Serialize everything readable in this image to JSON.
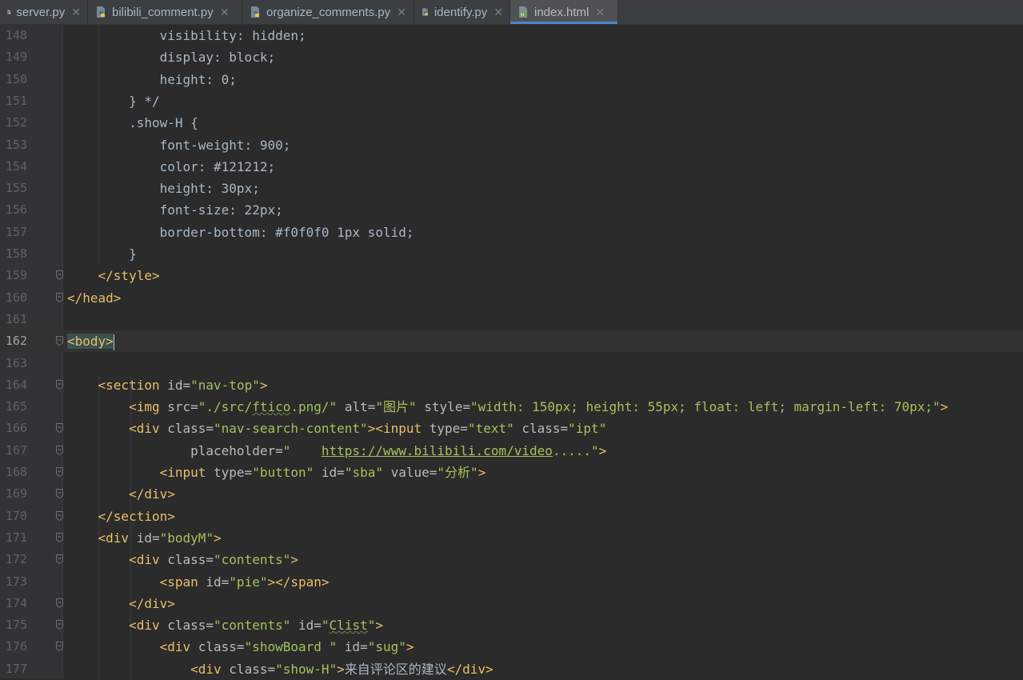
{
  "tabs": [
    {
      "label": "server.py",
      "icon": "python-file-icon",
      "active": false
    },
    {
      "label": "bilibili_comment.py",
      "icon": "python-file-icon",
      "active": false
    },
    {
      "label": "organize_comments.py",
      "icon": "python-file-icon",
      "active": false
    },
    {
      "label": "identify.py",
      "icon": "python-file-icon",
      "active": false
    },
    {
      "label": "index.html",
      "icon": "html-file-icon",
      "active": true
    }
  ],
  "colors": {
    "background": "#2b2b2b",
    "gutter": "#313335",
    "tag": "#e8bf6a",
    "string": "#a5c25c",
    "text": "#a9b7c6",
    "line_number": "#606366",
    "active_tab_underline": "#4a88c7"
  },
  "current_line": "162",
  "lines": [
    {
      "n": "148",
      "fold": false,
      "parts": [
        {
          "t": "            visibility: hidden;",
          "c": "kw"
        }
      ]
    },
    {
      "n": "149",
      "fold": false,
      "parts": [
        {
          "t": "            display: block;",
          "c": "kw"
        }
      ]
    },
    {
      "n": "150",
      "fold": false,
      "parts": [
        {
          "t": "            height: 0;",
          "c": "kw"
        }
      ]
    },
    {
      "n": "151",
      "fold": false,
      "parts": [
        {
          "t": "        } */",
          "c": "kw"
        }
      ]
    },
    {
      "n": "152",
      "fold": false,
      "parts": [
        {
          "t": "        .show-H {",
          "c": "kw"
        }
      ]
    },
    {
      "n": "153",
      "fold": false,
      "parts": [
        {
          "t": "            font-weight: 900;",
          "c": "kw"
        }
      ]
    },
    {
      "n": "154",
      "fold": false,
      "parts": [
        {
          "t": "            color: #121212;",
          "c": "kw"
        }
      ]
    },
    {
      "n": "155",
      "fold": false,
      "parts": [
        {
          "t": "            height: 30px;",
          "c": "kw"
        }
      ]
    },
    {
      "n": "156",
      "fold": false,
      "parts": [
        {
          "t": "            font-size: 22px;",
          "c": "kw"
        }
      ]
    },
    {
      "n": "157",
      "fold": false,
      "parts": [
        {
          "t": "            border-bottom: #f0f0f0 1px solid;",
          "c": "kw"
        }
      ]
    },
    {
      "n": "158",
      "fold": false,
      "parts": [
        {
          "t": "        }",
          "c": "kw"
        }
      ]
    },
    {
      "n": "159",
      "fold": true,
      "parts": [
        {
          "t": "    ",
          "c": "kw"
        },
        {
          "t": "</style>",
          "c": "tag"
        }
      ]
    },
    {
      "n": "160",
      "fold": true,
      "parts": [
        {
          "t": "</head>",
          "c": "tag"
        }
      ]
    },
    {
      "n": "161",
      "fold": false,
      "parts": []
    },
    {
      "n": "162",
      "fold": true,
      "parts": [
        {
          "t": "<body>",
          "c": "tag hl"
        },
        {
          "t": "",
          "c": "caret"
        }
      ]
    },
    {
      "n": "163",
      "fold": false,
      "parts": []
    },
    {
      "n": "164",
      "fold": true,
      "parts": [
        {
          "t": "    ",
          "c": "kw"
        },
        {
          "t": "<section ",
          "c": "tag"
        },
        {
          "t": "id=",
          "c": "attr"
        },
        {
          "t": "\"nav-top\"",
          "c": "str"
        },
        {
          "t": ">",
          "c": "tag"
        }
      ]
    },
    {
      "n": "165",
      "fold": false,
      "parts": [
        {
          "t": "        ",
          "c": "kw"
        },
        {
          "t": "<img ",
          "c": "tag"
        },
        {
          "t": "src=",
          "c": "attr"
        },
        {
          "t": "\"./src/",
          "c": "str"
        },
        {
          "t": "ftico",
          "c": "str typo"
        },
        {
          "t": ".png/\" ",
          "c": "str"
        },
        {
          "t": "alt=",
          "c": "attr"
        },
        {
          "t": "\"图片\" ",
          "c": "str"
        },
        {
          "t": "style=",
          "c": "attr"
        },
        {
          "t": "\"width: 150px; height: 55px; float: left; margin-left: 70px;\"",
          "c": "str"
        },
        {
          "t": ">",
          "c": "tag"
        }
      ]
    },
    {
      "n": "166",
      "fold": true,
      "parts": [
        {
          "t": "        ",
          "c": "kw"
        },
        {
          "t": "<div ",
          "c": "tag"
        },
        {
          "t": "class=",
          "c": "attr"
        },
        {
          "t": "\"nav-search-content\"",
          "c": "str"
        },
        {
          "t": "><input ",
          "c": "tag"
        },
        {
          "t": "type=",
          "c": "attr"
        },
        {
          "t": "\"text\" ",
          "c": "str"
        },
        {
          "t": "class=",
          "c": "attr"
        },
        {
          "t": "\"ipt\"",
          "c": "str"
        }
      ]
    },
    {
      "n": "167",
      "fold": true,
      "parts": [
        {
          "t": "                ",
          "c": "kw"
        },
        {
          "t": "placeholder=",
          "c": "attr"
        },
        {
          "t": "\"    ",
          "c": "str"
        },
        {
          "t": "https://www.bilibili.com/video",
          "c": "link"
        },
        {
          "t": ".....\"",
          "c": "str"
        },
        {
          "t": ">",
          "c": "tag"
        }
      ]
    },
    {
      "n": "168",
      "fold": true,
      "parts": [
        {
          "t": "            ",
          "c": "kw"
        },
        {
          "t": "<input ",
          "c": "tag"
        },
        {
          "t": "type=",
          "c": "attr"
        },
        {
          "t": "\"button\" ",
          "c": "str"
        },
        {
          "t": "id=",
          "c": "attr"
        },
        {
          "t": "\"sba\" ",
          "c": "str"
        },
        {
          "t": "value=",
          "c": "attr"
        },
        {
          "t": "\"分析\"",
          "c": "str"
        },
        {
          "t": ">",
          "c": "tag"
        }
      ]
    },
    {
      "n": "169",
      "fold": true,
      "parts": [
        {
          "t": "        ",
          "c": "kw"
        },
        {
          "t": "</div>",
          "c": "tag"
        }
      ]
    },
    {
      "n": "170",
      "fold": true,
      "parts": [
        {
          "t": "    ",
          "c": "kw"
        },
        {
          "t": "</section>",
          "c": "tag"
        }
      ]
    },
    {
      "n": "171",
      "fold": true,
      "parts": [
        {
          "t": "    ",
          "c": "kw"
        },
        {
          "t": "<div ",
          "c": "tag"
        },
        {
          "t": "id=",
          "c": "attr"
        },
        {
          "t": "\"bodyM\"",
          "c": "str"
        },
        {
          "t": ">",
          "c": "tag"
        }
      ]
    },
    {
      "n": "172",
      "fold": true,
      "parts": [
        {
          "t": "        ",
          "c": "kw"
        },
        {
          "t": "<div ",
          "c": "tag"
        },
        {
          "t": "class=",
          "c": "attr"
        },
        {
          "t": "\"contents\"",
          "c": "str"
        },
        {
          "t": ">",
          "c": "tag"
        }
      ]
    },
    {
      "n": "173",
      "fold": false,
      "parts": [
        {
          "t": "            ",
          "c": "kw"
        },
        {
          "t": "<span ",
          "c": "tag"
        },
        {
          "t": "id=",
          "c": "attr"
        },
        {
          "t": "\"pie\"",
          "c": "str"
        },
        {
          "t": "></span>",
          "c": "tag"
        }
      ]
    },
    {
      "n": "174",
      "fold": true,
      "parts": [
        {
          "t": "        ",
          "c": "kw"
        },
        {
          "t": "</div>",
          "c": "tag"
        }
      ]
    },
    {
      "n": "175",
      "fold": true,
      "parts": [
        {
          "t": "        ",
          "c": "kw"
        },
        {
          "t": "<div ",
          "c": "tag"
        },
        {
          "t": "class=",
          "c": "attr"
        },
        {
          "t": "\"contents\" ",
          "c": "str"
        },
        {
          "t": "id=",
          "c": "attr"
        },
        {
          "t": "\"",
          "c": "str"
        },
        {
          "t": "Clist",
          "c": "str typo"
        },
        {
          "t": "\"",
          "c": "str"
        },
        {
          "t": ">",
          "c": "tag"
        }
      ]
    },
    {
      "n": "176",
      "fold": true,
      "parts": [
        {
          "t": "            ",
          "c": "kw"
        },
        {
          "t": "<div ",
          "c": "tag"
        },
        {
          "t": "class=",
          "c": "attr"
        },
        {
          "t": "\"showBoard \" ",
          "c": "str"
        },
        {
          "t": "id=",
          "c": "attr"
        },
        {
          "t": "\"sug\"",
          "c": "str"
        },
        {
          "t": ">",
          "c": "tag"
        }
      ]
    },
    {
      "n": "177",
      "fold": false,
      "parts": [
        {
          "t": "                ",
          "c": "kw"
        },
        {
          "t": "<div ",
          "c": "tag"
        },
        {
          "t": "class=",
          "c": "attr"
        },
        {
          "t": "\"show-H\"",
          "c": "str"
        },
        {
          "t": ">",
          "c": "tag"
        },
        {
          "t": "来自评论区的建议",
          "c": "kw"
        },
        {
          "t": "</div>",
          "c": "tag"
        }
      ]
    }
  ]
}
